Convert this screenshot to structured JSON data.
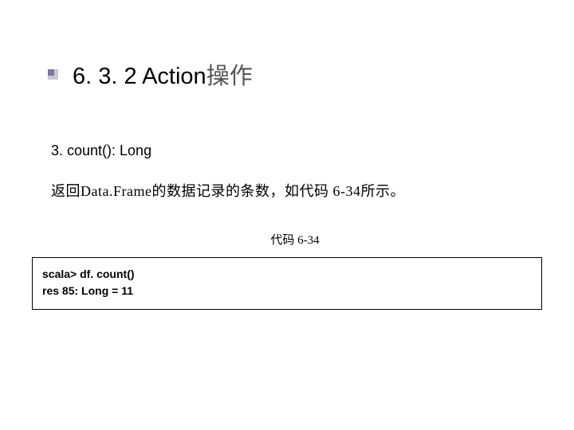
{
  "heading": {
    "number": "6. 3. 2 ",
    "title_en": "Action",
    "title_cn": "操作"
  },
  "subsection": "3. count(): Long",
  "description": "返回Data.Frame的数据记录的条数，如代码 6-34所示。",
  "code_label": "代码 6-34",
  "code": {
    "line1": "scala> df. count()",
    "line2_prefix": "res 85: Long = ",
    "line2_value": "11"
  }
}
